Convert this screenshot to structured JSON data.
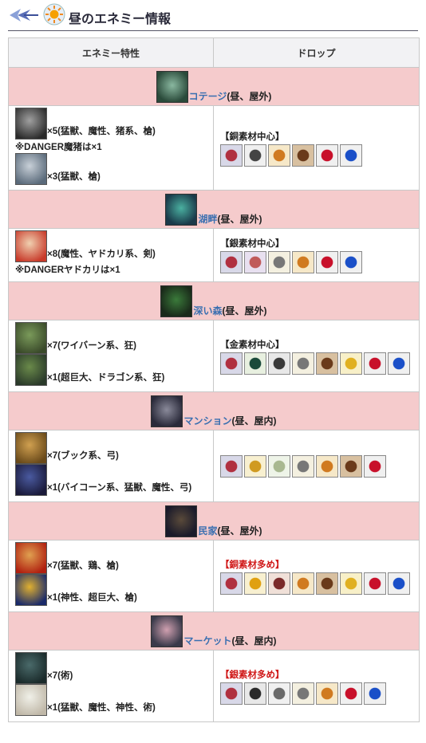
{
  "header": {
    "title": "昼のエネミー情報"
  },
  "table": {
    "col_enemy": "エネミー特性",
    "col_drop": "ドロップ",
    "areas": [
      {
        "name": "コテージ",
        "suffix": "(昼、屋外)",
        "enemies": [
          {
            "text": "×5(猛獣、魔性、猪系、槍)",
            "icon": "boar-enemy-icon",
            "danger": "※DANGER魔猪は×1"
          },
          {
            "text": "×3(猛獣、槍)",
            "icon": "wolf-enemy-icon"
          }
        ],
        "drop_label": "【銅素材中心】",
        "drop_red": false,
        "drops": [
          "skull-material-icon",
          "horseshoe-icon",
          "dumpling-icon",
          "wood-logs-icon",
          "red-gem-icon",
          "blue-gem-icon"
        ]
      },
      {
        "name": "湖畔",
        "suffix": "(昼、屋外)",
        "enemies": [
          {
            "text": "×8(魔性、ヤドカリ系、剣)",
            "icon": "hermit-crab-enemy-icon",
            "danger": "※DANGERヤドカリは×1"
          }
        ],
        "drop_label": "【銀素材中心】",
        "drop_red": false,
        "drops": [
          "skull-material-icon",
          "crystal-egg-icon",
          "chain-icon",
          "dumpling-icon",
          "red-gem-icon",
          "blue-gem-icon"
        ]
      },
      {
        "name": "深い森",
        "suffix": "(昼、屋外)",
        "enemies": [
          {
            "text": "×7(ワイバーン系、狂)",
            "icon": "wyvern-enemy-icon"
          },
          {
            "text": "×1(超巨大、ドラゴン系、狂)",
            "icon": "dragon-enemy-icon"
          }
        ],
        "drop_label": "【金素材中心】",
        "drop_red": false,
        "drops": [
          "skull-material-icon",
          "dragon-wing-icon",
          "dark-orb-icon",
          "chain-icon",
          "wood-logs-icon",
          "gold-spark-icon",
          "red-gem-icon",
          "blue-gem-icon"
        ]
      },
      {
        "name": "マンション",
        "suffix": "(昼、屋内)",
        "enemies": [
          {
            "text": "×7(ブック系、弓)",
            "icon": "book-enemy-icon"
          },
          {
            "text": "×1(バイコーン系、猛獣、魔性、弓)",
            "icon": "bicorn-enemy-icon"
          }
        ],
        "drop_label": "",
        "drop_red": false,
        "drops": [
          "skull-material-icon",
          "gold-horn-icon",
          "cloth-icon",
          "chain-icon",
          "dumpling-icon",
          "wood-logs-icon",
          "red-gem-icon"
        ]
      },
      {
        "name": "民家",
        "suffix": "(昼、屋外)",
        "enemies": [
          {
            "text": "×7(猛獣、鶏、槍)",
            "icon": "rooster-enemy-icon"
          },
          {
            "text": "×1(神性、超巨大、槍)",
            "icon": "pharaoh-enemy-icon"
          }
        ],
        "drop_label": "【銅素材多め】",
        "drop_red": true,
        "drops": [
          "skull-material-icon",
          "gold-lamp-icon",
          "meat-icon",
          "dumpling-icon",
          "wood-logs-icon",
          "gold-spark-icon",
          "red-gem-icon",
          "blue-gem-icon"
        ]
      },
      {
        "name": "マーケット",
        "suffix": "(昼、屋内)",
        "enemies": [
          {
            "text": "×7(術)",
            "icon": "lizard-enemy-icon"
          },
          {
            "text": "×1(猛獣、魔性、神性、術)",
            "icon": "sheep-enemy-icon"
          }
        ],
        "drop_label": "【銀素材多め】",
        "drop_red": true,
        "drops": [
          "skull-material-icon",
          "cauldron-icon",
          "claw-icon",
          "chain-icon",
          "dumpling-icon",
          "red-gem-icon",
          "blue-gem-icon"
        ]
      }
    ]
  }
}
